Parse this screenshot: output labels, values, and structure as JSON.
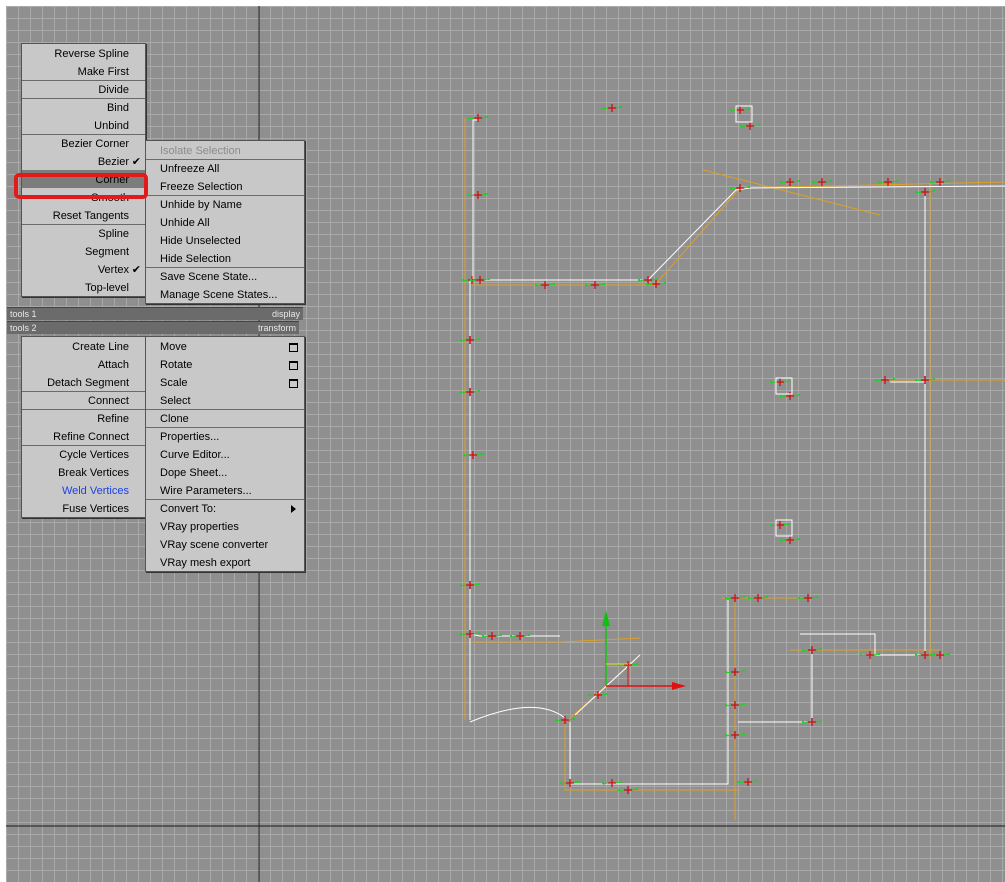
{
  "quad_menu": {
    "left_top": [
      {
        "label": "Reverse Spline"
      },
      {
        "label": "Make First"
      },
      {
        "label": "Divide",
        "sep": true
      },
      {
        "label": "Bind",
        "sep": true
      },
      {
        "label": "Unbind"
      },
      {
        "label": "Bezier Corner",
        "sep": true
      },
      {
        "label": "Bezier",
        "checked": true
      },
      {
        "label": "Corner",
        "highlighted": true
      },
      {
        "label": "Smooth"
      },
      {
        "label": "Reset Tangents"
      },
      {
        "label": "Spline",
        "sep": true
      },
      {
        "label": "Segment"
      },
      {
        "label": "Vertex",
        "checked": true
      },
      {
        "label": "Top-level"
      }
    ],
    "right_top": [
      {
        "label": "Isolate Selection",
        "disabled": true
      },
      {
        "label": "Unfreeze All",
        "sep": true
      },
      {
        "label": "Freeze Selection"
      },
      {
        "label": "Unhide by Name",
        "sep": true
      },
      {
        "label": "Unhide All"
      },
      {
        "label": "Hide Unselected"
      },
      {
        "label": "Hide Selection"
      },
      {
        "label": "Save Scene State...",
        "sep": true
      },
      {
        "label": "Manage Scene States..."
      }
    ],
    "quad_labels": {
      "tools1": "tools 1",
      "display": "display",
      "tools2": "tools 2",
      "transform": "transform"
    },
    "left_bottom": [
      {
        "label": "Create Line"
      },
      {
        "label": "Attach"
      },
      {
        "label": "Detach Segment"
      },
      {
        "label": "Connect",
        "sep": true
      },
      {
        "label": "Refine",
        "sep": true
      },
      {
        "label": "Refine Connect"
      },
      {
        "label": "Cycle Vertices",
        "sep": true
      },
      {
        "label": "Break Vertices"
      },
      {
        "label": "Weld Vertices",
        "blue": true
      },
      {
        "label": "Fuse Vertices"
      }
    ],
    "right_bottom": [
      {
        "label": "Move",
        "box": true
      },
      {
        "label": "Rotate",
        "box": true
      },
      {
        "label": "Scale",
        "box": true
      },
      {
        "label": "Select"
      },
      {
        "label": "Clone",
        "sep": true
      },
      {
        "label": "Properties...",
        "sep": true
      },
      {
        "label": "Curve Editor..."
      },
      {
        "label": "Dope Sheet..."
      },
      {
        "label": "Wire Parameters..."
      },
      {
        "label": "Convert To:",
        "sep": true,
        "submenu": true
      },
      {
        "label": "VRay properties"
      },
      {
        "label": "VRay scene converter"
      },
      {
        "label": "VRay mesh export"
      }
    ]
  },
  "colors": {
    "viewport_bg": "#8f8f8f",
    "grid": "#a9a9a9",
    "world_axis": "#1a1a1a",
    "spline_white": "#ffffff",
    "spline_yellow": "#e0a020",
    "tangent_green": "#20d020",
    "vertex_red": "#d01010",
    "gizmo_x": "#e01010",
    "gizmo_y": "#10c010",
    "highlight_frame": "#e11b1b"
  }
}
